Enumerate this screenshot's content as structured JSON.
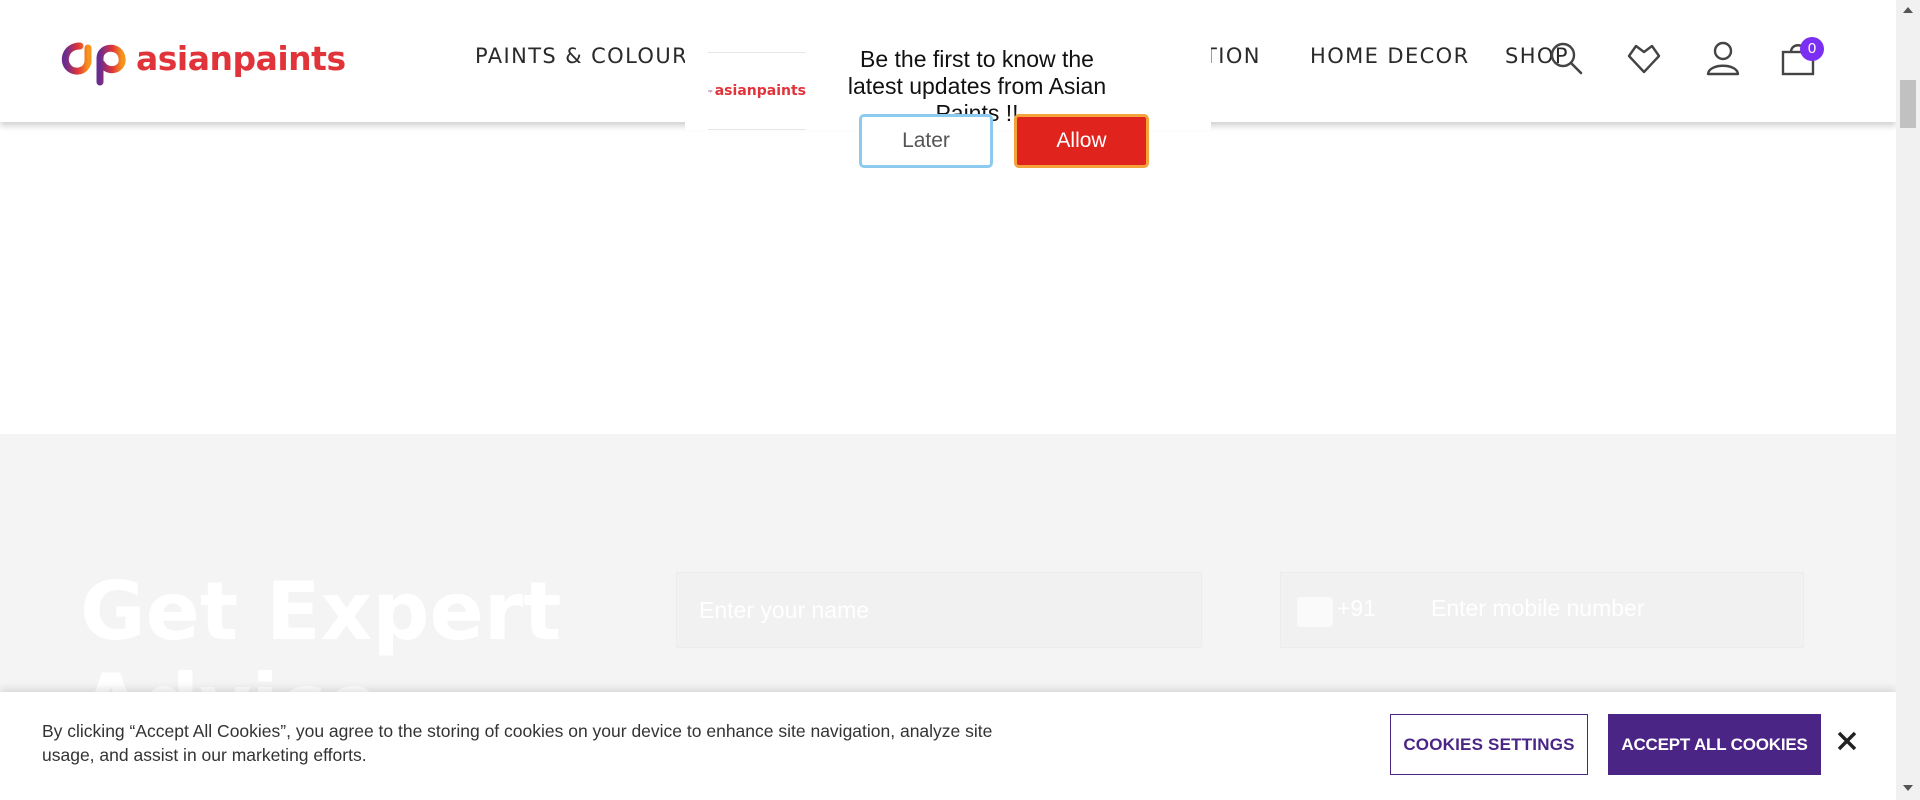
{
  "brand": {
    "name": "asianpaints",
    "color": "#e0343a"
  },
  "nav": {
    "items": [
      {
        "label": "PAINTS & COLOURS"
      },
      {
        "label": "TION"
      },
      {
        "label": "HOME DECOR"
      },
      {
        "label": "SHOP"
      }
    ]
  },
  "header_icons": {
    "search": "search-icon",
    "wishlist": "heart-icon",
    "account": "user-icon",
    "cart": "cart-icon",
    "cart_count": "0"
  },
  "notification": {
    "message": "Be the first to know the latest updates from Asian Paints !!",
    "later_label": "Later",
    "allow_label": "Allow",
    "logo_text": "asianpaints"
  },
  "expert": {
    "title": "Get Expert Advice",
    "name_placeholder": "Enter your name",
    "country_code": "+91",
    "mobile_placeholder": "Enter mobile number"
  },
  "cookie": {
    "text": "By clicking “Accept All Cookies”, you agree to the storing of cookies on your device to enhance site navigation, analyze site usage, and assist in our marketing efforts.",
    "settings_label": "COOKIES SETTINGS",
    "accept_label": "ACCEPT ALL COOKIES"
  },
  "colors": {
    "accent_purple": "#4b2586",
    "allow_red": "#e0231d",
    "badge_purple": "#7b2ff2"
  }
}
